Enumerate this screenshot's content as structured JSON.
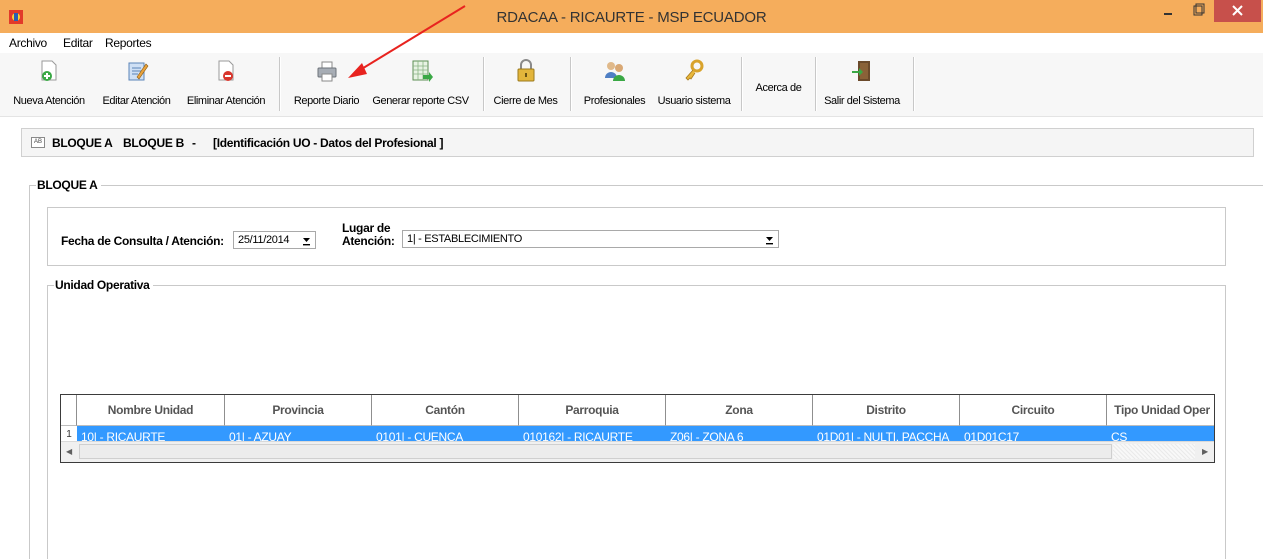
{
  "window": {
    "title": "RDACAA - RICAURTE - MSP ECUADOR",
    "colors": {
      "titlebar": "#f5ad5c",
      "close_button": "#c7504b",
      "selection": "#3399ff",
      "annotation_arrow": "#e8231f"
    }
  },
  "menu": {
    "items": [
      "Archivo",
      "Editar",
      "Reportes"
    ]
  },
  "toolbar": {
    "nueva_atencion": "Nueva Atención",
    "editar_atencion": "Editar Atención",
    "eliminar_atencion": "Eliminar Atención",
    "reporte_diario": "Reporte Diario",
    "generar_csv": "Generar reporte CSV",
    "cierre_mes": "Cierre de Mes",
    "profesionales": "Profesionales",
    "usuario_sistema": "Usuario sistema",
    "acerca_de": "Acerca de",
    "salir": "Salir del Sistema"
  },
  "header": {
    "icon_text": "AB",
    "bloque_a": "BLOQUE A",
    "bloque_b": "BLOQUE B",
    "dash": "-",
    "section": "[Identificación UO - Datos del Profesional ]"
  },
  "bloque_a": {
    "legend": "BLOQUE A",
    "fecha_label": "Fecha de Consulta / Atención:",
    "fecha_value": "25/11/2014",
    "lugar_label_1": "Lugar de",
    "lugar_label_2": "Atención:",
    "lugar_value": "1| - ESTABLECIMIENTO"
  },
  "unidad": {
    "legend": "Unidad Operativa",
    "columns": [
      "Nombre Unidad",
      "Provincia",
      "Cantón",
      "Parroquia",
      "Zona",
      "Distrito",
      "Circuito",
      "Tipo Unidad Oper"
    ],
    "rows": [
      {
        "index": "1",
        "cells": [
          "10| - RICAURTE",
          "01| - AZUAY",
          "0101| - CUENCA",
          "010162| - RICAURTE",
          "Z06| - ZONA 6",
          "01D01| - NULTI, PACCHA",
          "01D01C17",
          "CS"
        ]
      }
    ]
  }
}
